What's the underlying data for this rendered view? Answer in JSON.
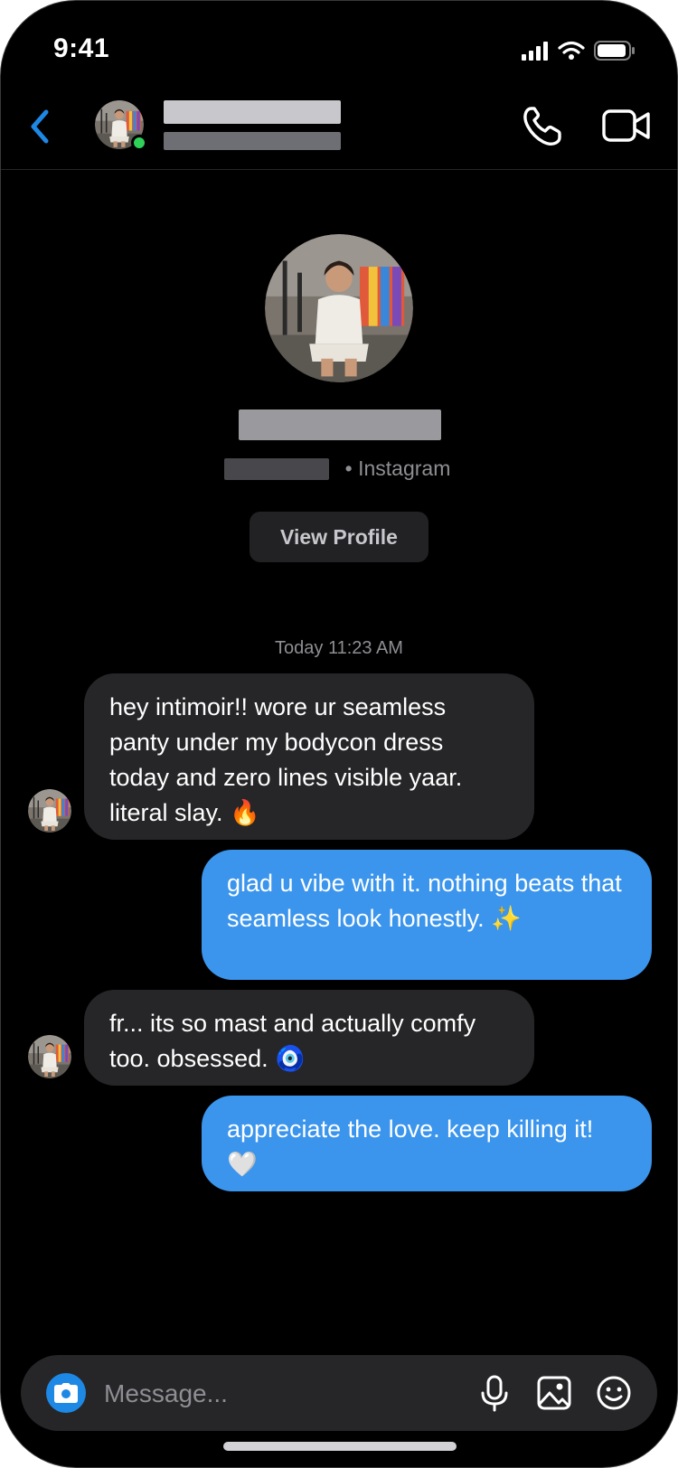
{
  "status_bar": {
    "time": "9:41"
  },
  "header": {
    "contact_name": "",
    "contact_username": "",
    "online": true
  },
  "profile": {
    "name": "",
    "username": "",
    "source_label": "• Instagram",
    "view_profile_label": "View Profile"
  },
  "conversation": {
    "timestamp": "Today 11:23 AM",
    "messages": [
      {
        "direction": "incoming",
        "text": "hey intimoir!! wore ur seamless panty under my bodycon dress today and zero lines visible yaar. literal slay. 🔥"
      },
      {
        "direction": "outgoing",
        "text": "glad u vibe with it. nothing beats that seamless look honestly. ✨"
      },
      {
        "direction": "incoming",
        "text": "fr... its so mast and actually comfy too. obsessed. 🧿"
      },
      {
        "direction": "outgoing",
        "text": "appreciate the love. keep killing it! 🤍"
      }
    ]
  },
  "composer": {
    "placeholder": "Message...",
    "value": ""
  },
  "icons": {
    "back": "chevron-left-icon",
    "call": "phone-icon",
    "video": "video-camera-icon",
    "camera": "camera-icon",
    "mic": "microphone-icon",
    "gallery": "image-icon",
    "sticker": "smiley-icon"
  },
  "colors": {
    "accent": "#3b95ec",
    "incoming_bubble": "#262628",
    "online": "#30d158",
    "back_chevron": "#1e88e5"
  }
}
